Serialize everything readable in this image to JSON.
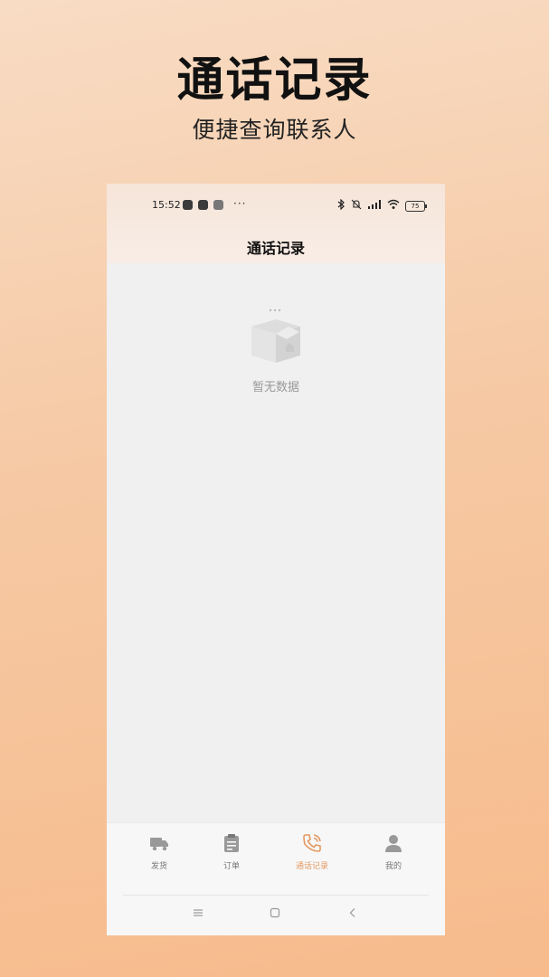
{
  "hero": {
    "title": "通话记录",
    "subtitle": "便捷查询联系人"
  },
  "status_bar": {
    "time": "15:52",
    "dots": "···",
    "battery": "75"
  },
  "header": {
    "title": "通话记录"
  },
  "empty_state": {
    "text": "暂无数据"
  },
  "tabs": [
    {
      "label": "发货",
      "icon": "truck-icon",
      "active": false
    },
    {
      "label": "订单",
      "icon": "clipboard-icon",
      "active": false
    },
    {
      "label": "通话记录",
      "icon": "phone-call-icon",
      "active": true
    },
    {
      "label": "我的",
      "icon": "user-icon",
      "active": false
    }
  ],
  "colors": {
    "accent": "#e49a62",
    "background": "#f0f0f0"
  }
}
